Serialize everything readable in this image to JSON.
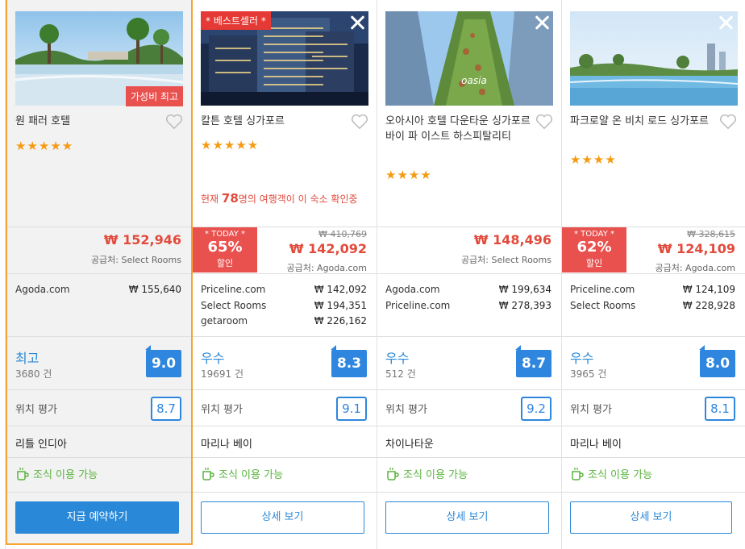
{
  "hotels": [
    {
      "name": "원 패러 호텔",
      "photo_tag": "가성비 최고",
      "stars": "★★★★★",
      "price": "₩ 152,946",
      "supplier": "공급처: Select Rooms",
      "offers": [
        {
          "site": "Agoda.com",
          "price": "₩ 155,640"
        }
      ],
      "rating_word": "최고",
      "review_count": "3680 건",
      "score": "9.0",
      "location_label": "위치 평가",
      "location_score": "8.7",
      "area": "리틀 인디아",
      "breakfast": "조식 이용 가능",
      "button": "지금 예약하기"
    },
    {
      "name": "칼튼 호텔 싱가포르",
      "photo_tag": "* 베스트셀러 *",
      "stars": "★★★★★",
      "viewers_prefix": "현재 ",
      "viewers_count": "78",
      "viewers_suffix": "명의 여행객이 이 숙소 확인중",
      "today_label": "* TODAY *",
      "discount": "65%",
      "discount_unit": "할인",
      "old_price": "₩ 410,769",
      "price": "₩ 142,092",
      "supplier": "공급처: Agoda.com",
      "offers": [
        {
          "site": "Priceline.com",
          "price": "₩ 142,092"
        },
        {
          "site": "Select Rooms",
          "price": "₩ 194,351"
        },
        {
          "site": "getaroom",
          "price": "₩ 226,162"
        }
      ],
      "rating_word": "우수",
      "review_count": "19691 건",
      "score": "8.3",
      "location_label": "위치 평가",
      "location_score": "9.1",
      "area": "마리나 베이",
      "breakfast": "조식 이용 가능",
      "button": "상세 보기"
    },
    {
      "name": "오아시아 호텔 다운타운 싱가포르 바이 파 이스트 하스피탈리티",
      "stars": "★★★★",
      "price": "₩ 148,496",
      "supplier": "공급처: Select Rooms",
      "offers": [
        {
          "site": "Agoda.com",
          "price": "₩ 199,634"
        },
        {
          "site": "Priceline.com",
          "price": "₩ 278,393"
        }
      ],
      "rating_word": "우수",
      "review_count": "512 건",
      "score": "8.7",
      "location_label": "위치 평가",
      "location_score": "9.2",
      "area": "차이나타운",
      "breakfast": "조식 이용 가능",
      "button": "상세 보기"
    },
    {
      "name": "파크로얄 온 비치 로드 싱가포르",
      "stars": "★★★★",
      "today_label": "* TODAY *",
      "discount": "62%",
      "discount_unit": "할인",
      "old_price": "₩ 328,615",
      "price": "₩ 124,109",
      "supplier": "공급처: Agoda.com",
      "offers": [
        {
          "site": "Priceline.com",
          "price": "₩ 124,109"
        },
        {
          "site": "Select Rooms",
          "price": "₩ 228,928"
        }
      ],
      "rating_word": "우수",
      "review_count": "3965 건",
      "score": "8.0",
      "location_label": "위치 평가",
      "location_score": "8.1",
      "area": "마리나 베이",
      "breakfast": "조식 이용 가능",
      "button": "상세 보기"
    }
  ],
  "colors": {
    "accent": "#2a88d8",
    "price": "#e24a3b",
    "star": "#f59b11",
    "highlight_border": "#f6a531",
    "breakfast": "#58b33d"
  }
}
